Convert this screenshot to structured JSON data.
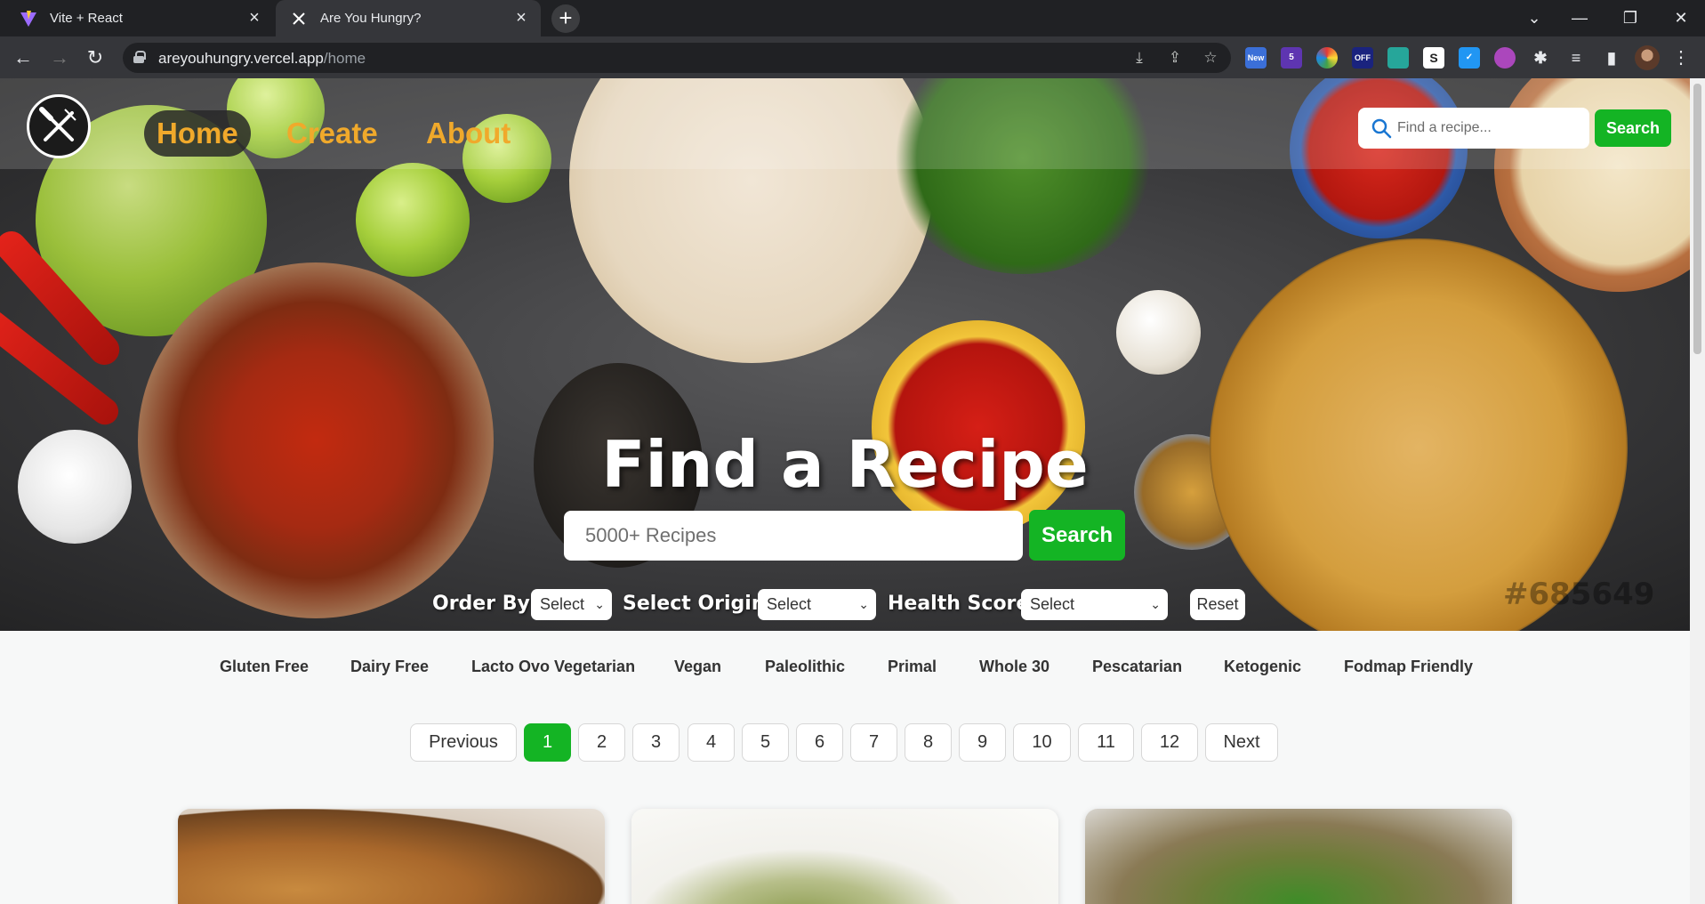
{
  "browser": {
    "tabs": [
      {
        "title": "Vite + React",
        "favicon": "vite-icon",
        "active": false
      },
      {
        "title": "Are You Hungry?",
        "favicon": "fork-knife-icon",
        "active": true
      }
    ],
    "url_host": "areyouhungry.vercel.app",
    "url_path": "/home",
    "extensions": [
      {
        "name": "new-badge-extension-icon",
        "badge": "New",
        "color": "#3b6fd8"
      },
      {
        "name": "graduation-cap-extension-icon",
        "badge": "5",
        "color": "#5e35b1"
      },
      {
        "name": "color-wheel-extension-icon",
        "badge": "",
        "color": "#e53935"
      },
      {
        "name": "off-badge-extension-icon",
        "badge": "OFF",
        "color": "#1a237e"
      },
      {
        "name": "leaf-extension-icon",
        "badge": "",
        "color": "#26a69a"
      },
      {
        "name": "s-extension-icon",
        "badge": "S",
        "color": "#ffffff"
      },
      {
        "name": "check-extension-icon",
        "badge": "",
        "color": "#2196f3"
      },
      {
        "name": "sparkle-extension-icon",
        "badge": "",
        "color": "#ab47bc"
      }
    ]
  },
  "header": {
    "nav": [
      {
        "label": "Home",
        "active": true
      },
      {
        "label": "Create",
        "active": false
      },
      {
        "label": "About",
        "active": false
      }
    ],
    "search_placeholder": "Find a recipe...",
    "search_button": "Search"
  },
  "hero": {
    "title": "Find a Recipe",
    "search_placeholder": "5000+ Recipes",
    "search_button": "Search",
    "watermark": "#685649",
    "filters": {
      "order_by": {
        "label": "Order By:",
        "value": "Select"
      },
      "origin": {
        "label": "Select Origin:",
        "value": "Select"
      },
      "health": {
        "label": "Health Score:",
        "value": "Select"
      },
      "reset": "Reset"
    }
  },
  "diets": [
    "Gluten Free",
    "Dairy Free",
    "Lacto Ovo Vegetarian",
    "Vegan",
    "Paleolithic",
    "Primal",
    "Whole 30",
    "Pescatarian",
    "Ketogenic",
    "Fodmap Friendly"
  ],
  "pagination": {
    "previous": "Previous",
    "next": "Next",
    "pages": [
      "1",
      "2",
      "3",
      "4",
      "5",
      "6",
      "7",
      "8",
      "9",
      "10",
      "11",
      "12"
    ],
    "current": "1"
  },
  "colors": {
    "accent_green": "#14b424",
    "nav_orange": "#f0a92b"
  }
}
